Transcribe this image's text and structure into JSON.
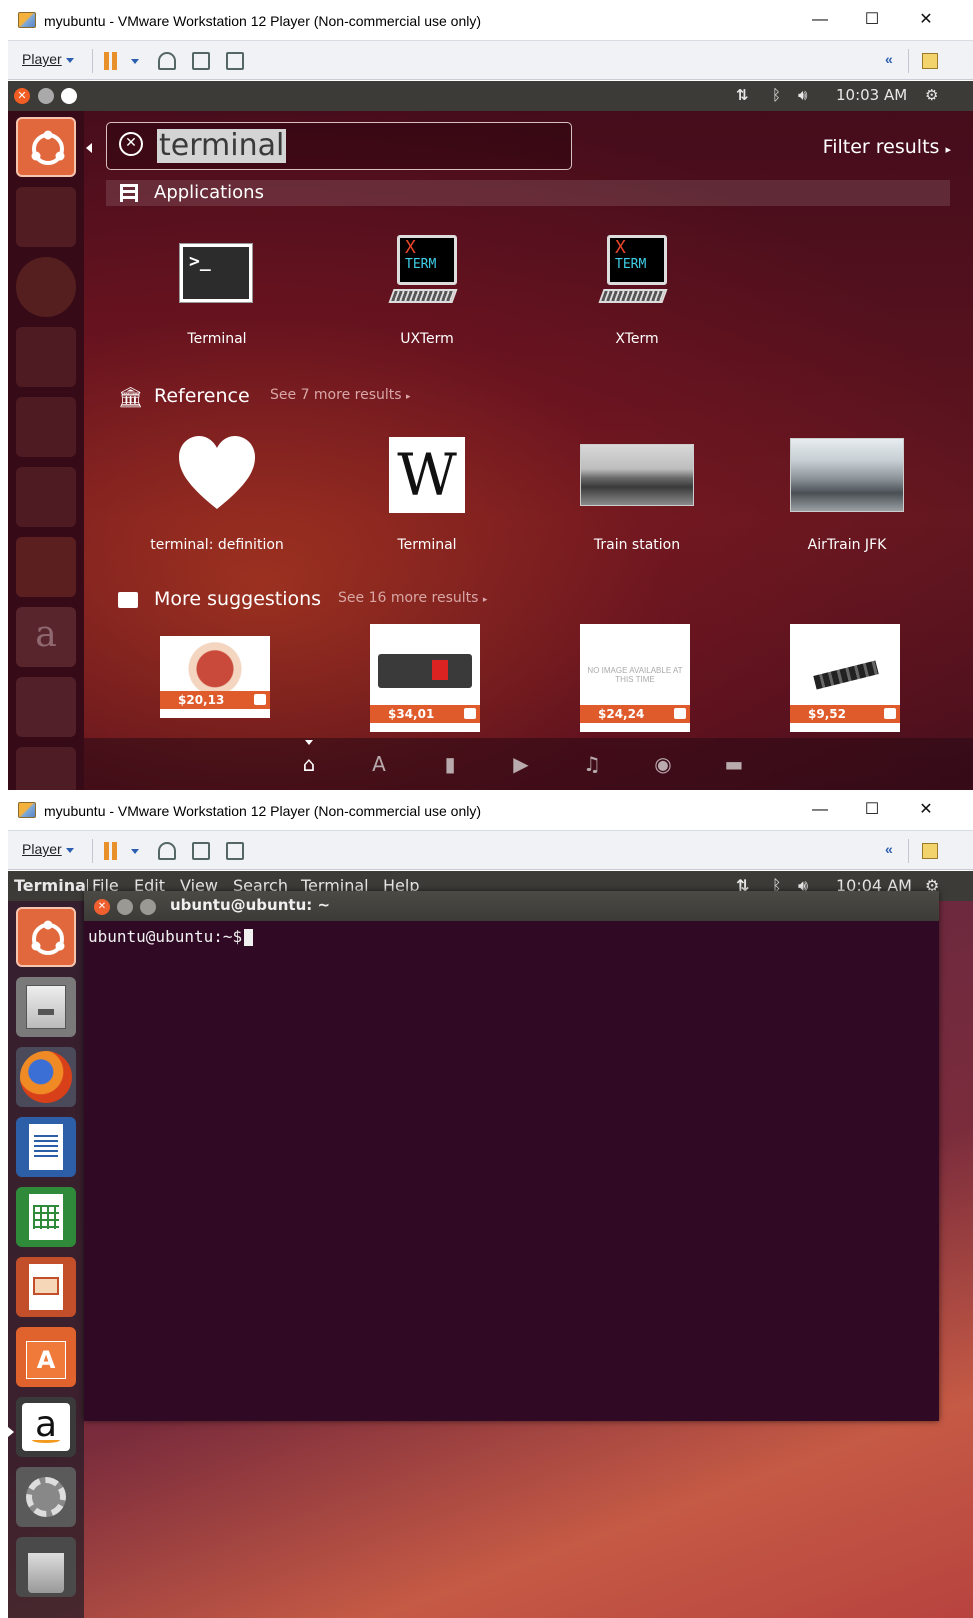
{
  "top_window": {
    "title": "myubuntu - VMware Workstation 12 Player (Non-commercial use only)",
    "player_label": "Player",
    "clock": "10:03 AM"
  },
  "dash": {
    "search_value": "terminal",
    "filter_label": "Filter results",
    "applications": {
      "title": "Applications",
      "items": [
        {
          "label": "Terminal",
          "icon": "terminal-icon"
        },
        {
          "label": "UXTerm",
          "icon": "xterm-icon"
        },
        {
          "label": "XTerm",
          "icon": "xterm-icon"
        }
      ],
      "xterm_top": "X",
      "xterm_bottom": "TERM"
    },
    "reference": {
      "title": "Reference",
      "more": "See 7 more results",
      "items": [
        {
          "label": "terminal: definition",
          "icon": "heart-icon"
        },
        {
          "label": "Terminal",
          "icon": "wikipedia-icon",
          "glyph": "W"
        },
        {
          "label": "Train station",
          "icon": "photo-train-station"
        },
        {
          "label": "AirTrain JFK",
          "icon": "photo-airtrain"
        }
      ]
    },
    "suggestions": {
      "title": "More suggestions",
      "more": "See 16 more results",
      "items": [
        {
          "price": "$20,13"
        },
        {
          "price": "$34,01"
        },
        {
          "price": "$24,24",
          "placeholder": "NO IMAGE AVAILABLE AT THIS TIME"
        },
        {
          "price": "$9,52"
        }
      ]
    },
    "lenses": [
      "home-lens-icon",
      "apps-lens-icon",
      "files-lens-icon",
      "video-lens-icon",
      "music-lens-icon",
      "photo-lens-icon",
      "social-lens-icon"
    ]
  },
  "bottom_window": {
    "title": "myubuntu - VMware Workstation 12 Player (Non-commercial use only)",
    "player_label": "Player",
    "clock": "10:04 AM",
    "app_name": "Terminal",
    "menu": [
      "File",
      "Edit",
      "View",
      "Search",
      "Terminal",
      "Help"
    ],
    "terminal_title": "ubuntu@ubuntu: ~",
    "prompt": "ubuntu@ubuntu:~$"
  },
  "colors": {
    "ubuntu_orange": "#e95420",
    "terminal_bg": "#300a24",
    "panel": "#3c3b37"
  }
}
